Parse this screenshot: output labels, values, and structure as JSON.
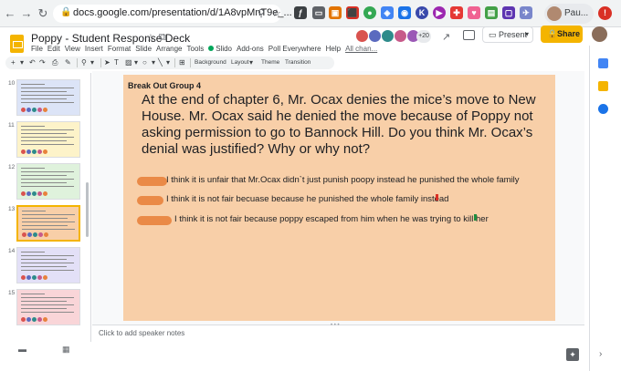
{
  "browser": {
    "url": "docs.google.com/presentation/d/1A8vpMnT9e_...",
    "profile_name": "Pau..."
  },
  "document": {
    "title": "Poppy - Student Response Deck"
  },
  "menu": [
    "File",
    "Edit",
    "View",
    "Insert",
    "Format",
    "Slide",
    "Arrange",
    "Tools",
    "Slido",
    "Add-ons",
    "Poll Everywhere",
    "Help",
    "All chan..."
  ],
  "collaborators": {
    "extra_count": "+20",
    "colors": [
      "#d9534f",
      "#5b6abf",
      "#2e8b8b",
      "#c75a8a",
      "#9b59b6"
    ]
  },
  "header_buttons": {
    "present": "Present",
    "share": "Share"
  },
  "toolbar": {
    "background": "Background",
    "layout": "Layout",
    "theme": "Theme",
    "transition": "Transition"
  },
  "filmstrip": {
    "slides": [
      {
        "num": "10",
        "bg": "#dce4f7",
        "active": false
      },
      {
        "num": "11",
        "bg": "#fdf3c9",
        "active": false
      },
      {
        "num": "12",
        "bg": "#dff2dc",
        "active": false
      },
      {
        "num": "13",
        "bg": "#f8cfa8",
        "active": true
      },
      {
        "num": "14",
        "bg": "#e3e0f7",
        "active": false
      },
      {
        "num": "15",
        "bg": "#f9d5d8",
        "active": false
      }
    ]
  },
  "slide": {
    "group": "Break Out Group 4",
    "question": "At the end of chapter 6, Mr. Ocax denies the mice’s move to New House. Mr. Ocax said he denied the move because of Poppy not asking permission to go to Bannock Hill. Do you think Mr. Ocax’s denial was justified? Why or why not?",
    "answers": [
      "I think it is unfair that Mr.Ocax didn`t just punish poopy instead he punished the whole family",
      "I think it is not fair becuase because he punished the whole family instead",
      "I think it is not fair because poppy escaped from him when he was trying to kill her"
    ],
    "background": "#f8cfa8"
  },
  "notes": {
    "placeholder": "Click to add speaker notes"
  },
  "colors": {
    "accent": "#f4b400",
    "redaction": "#e8823c"
  }
}
